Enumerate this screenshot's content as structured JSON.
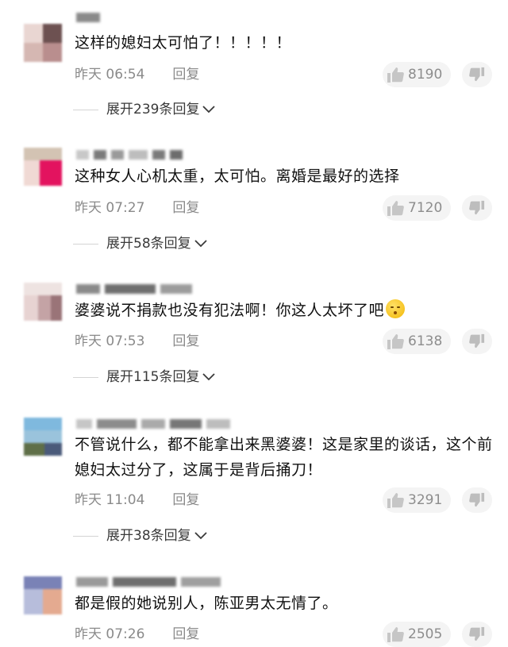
{
  "comments": [
    {
      "text": "这样的媳妇太可怕了！！！！！",
      "time": "昨天 06:54",
      "reply_label": "回复",
      "likes": "8190",
      "expand_label": "展开239条回复",
      "avatar_colors": [
        "#e9d6d2",
        "#b98e8e",
        "#6d5151",
        "#d5b7b2"
      ],
      "username_colors": [
        "#8a8a8a"
      ]
    },
    {
      "text": "这种女人心机太重，太可怕。离婚是最好的选择",
      "time": "昨天 07:27",
      "reply_label": "回复",
      "likes": "7120",
      "expand_label": "展开58条回复",
      "avatar_colors": [
        "#d3c3b3",
        "#e3135f",
        "#f0d9d4",
        "#c9b9ad"
      ],
      "username_colors": [
        "#c8c8c8",
        "#7a7a7a",
        "#9a9a9a",
        "#bdbdbd",
        "#7a7a7a",
        "#6d6d6d"
      ]
    },
    {
      "text": "婆婆说不捐款也没有犯法啊！你这人太坏了吧",
      "time": "昨天 07:53",
      "reply_label": "回复",
      "likes": "6138",
      "expand_label": "展开115条回复",
      "avatar_colors": [
        "#eee3e1",
        "#c4a3a5",
        "#9a7478",
        "#e7d3d2"
      ],
      "username_colors": [
        "#8a8a8a",
        "#6f6f6f",
        "#9c9c9c"
      ]
    },
    {
      "text": "不管说什么，都不能拿出来黑婆婆！这是家里的谈话，这个前媳妇太过分了，这属于是背后捅刀！",
      "time": "昨天 11:04",
      "reply_label": "回复",
      "likes": "3291",
      "expand_label": "展开38条回复",
      "avatar_colors": [
        "#7fb9de",
        "#5f6f48",
        "#4a5a7a",
        "#9ac3dc"
      ],
      "username_colors": [
        "#c6c6c6",
        "#8c8c8c",
        "#aaaaaa",
        "#777777",
        "#bdbdbd"
      ]
    },
    {
      "text": "都是假的她说别人，陈亚男太无情了。",
      "time": "昨天 07:26",
      "reply_label": "回复",
      "likes": "2505",
      "avatar_colors": [
        "#7a82b6",
        "#e4aa90",
        "#b7bddb",
        "#f0c6b3"
      ],
      "username_colors": [
        "#9a9a9a",
        "#6e6e6e",
        "#9f9f9f"
      ]
    }
  ]
}
